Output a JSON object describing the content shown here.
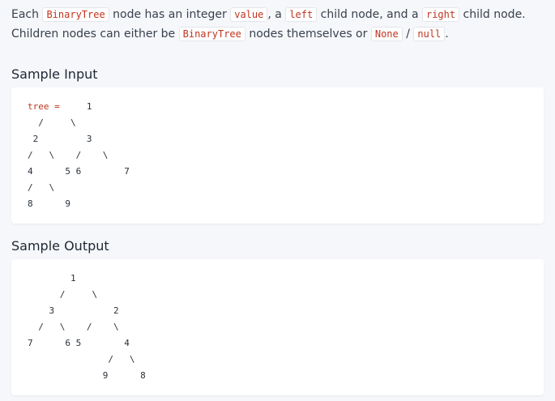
{
  "description": {
    "t1": "Each ",
    "c_binarytree": "BinaryTree",
    "t2": " node has an integer ",
    "c_value": "value",
    "t3": ", a ",
    "c_left": "left",
    "t4": " child node, and a ",
    "c_right": "right",
    "t5": " child node. Children nodes can either be ",
    "c_binarytree2": "BinaryTree",
    "t6": " nodes themselves or ",
    "c_none": "None",
    "t7": " / ",
    "c_null": "null",
    "t8": "."
  },
  "sample_input": {
    "heading": "Sample Input",
    "var_label": "tree =",
    "tree_text": "     1\n  /     \\\n 2         3\n/   \\    /    \\\n4      5 6        7\n/   \\\n8      9"
  },
  "sample_output": {
    "heading": "Sample Output",
    "tree_text": "        1\n      /     \\\n    3           2\n  /   \\    /    \\\n7      6 5        4\n               /   \\\n              9      8"
  }
}
